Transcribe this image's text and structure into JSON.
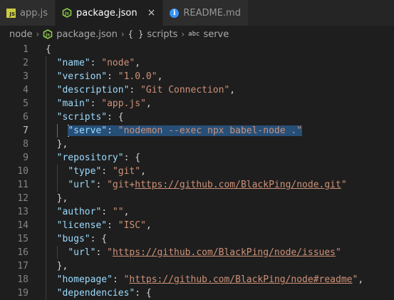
{
  "tabs": [
    {
      "label": "app.js",
      "icon": "js-icon",
      "active": false
    },
    {
      "label": "package.json",
      "icon": "nodejs-icon",
      "active": true,
      "close": "×"
    },
    {
      "label": "README.md",
      "icon": "info-icon",
      "active": false
    }
  ],
  "breadcrumb": {
    "root": "node",
    "file": "package.json",
    "section": "scripts",
    "section_glyph": "{ }",
    "leaf": "serve",
    "leaf_glyph": "abc",
    "separator": "›"
  },
  "editor": {
    "current_line": 7,
    "lines": [
      {
        "n": "1",
        "tokens": [
          [
            "p",
            "{"
          ]
        ]
      },
      {
        "n": "2",
        "tokens": [
          [
            "p",
            "  "
          ],
          [
            "k",
            "\"name\""
          ],
          [
            "p",
            ": "
          ],
          [
            "s",
            "\"node\""
          ],
          [
            "p",
            ","
          ]
        ]
      },
      {
        "n": "3",
        "tokens": [
          [
            "p",
            "  "
          ],
          [
            "k",
            "\"version\""
          ],
          [
            "p",
            ": "
          ],
          [
            "s",
            "\"1.0.0\""
          ],
          [
            "p",
            ","
          ]
        ]
      },
      {
        "n": "4",
        "tokens": [
          [
            "p",
            "  "
          ],
          [
            "k",
            "\"description\""
          ],
          [
            "p",
            ": "
          ],
          [
            "s",
            "\"Git Connection\""
          ],
          [
            "p",
            ","
          ]
        ]
      },
      {
        "n": "5",
        "tokens": [
          [
            "p",
            "  "
          ],
          [
            "k",
            "\"main\""
          ],
          [
            "p",
            ": "
          ],
          [
            "s",
            "\"app.js\""
          ],
          [
            "p",
            ","
          ]
        ]
      },
      {
        "n": "6",
        "tokens": [
          [
            "p",
            "  "
          ],
          [
            "k",
            "\"scripts\""
          ],
          [
            "p",
            ": {"
          ]
        ]
      },
      {
        "n": "7",
        "tokens": [
          [
            "p",
            "    "
          ],
          [
            "k",
            "\"serve\"",
            "sel"
          ],
          [
            "p",
            ": ",
            "sel"
          ],
          [
            "s",
            "\"nodemon --exec npx babel-node .\"",
            "sel"
          ]
        ]
      },
      {
        "n": "8",
        "tokens": [
          [
            "p",
            "  },"
          ]
        ]
      },
      {
        "n": "9",
        "tokens": [
          [
            "p",
            "  "
          ],
          [
            "k",
            "\"repository\""
          ],
          [
            "p",
            ": {"
          ]
        ]
      },
      {
        "n": "10",
        "tokens": [
          [
            "p",
            "    "
          ],
          [
            "k",
            "\"type\""
          ],
          [
            "p",
            ": "
          ],
          [
            "s",
            "\"git\""
          ],
          [
            "p",
            ","
          ]
        ]
      },
      {
        "n": "11",
        "tokens": [
          [
            "p",
            "    "
          ],
          [
            "k",
            "\"url\""
          ],
          [
            "p",
            ": "
          ],
          [
            "s",
            "\"git+"
          ],
          [
            "u",
            "https://github.com/BlackPing/node.git"
          ],
          [
            "s",
            "\""
          ]
        ]
      },
      {
        "n": "12",
        "tokens": [
          [
            "p",
            "  },"
          ]
        ]
      },
      {
        "n": "13",
        "tokens": [
          [
            "p",
            "  "
          ],
          [
            "k",
            "\"author\""
          ],
          [
            "p",
            ": "
          ],
          [
            "s",
            "\"\""
          ],
          [
            "p",
            ","
          ]
        ]
      },
      {
        "n": "14",
        "tokens": [
          [
            "p",
            "  "
          ],
          [
            "k",
            "\"license\""
          ],
          [
            "p",
            ": "
          ],
          [
            "s",
            "\"ISC\""
          ],
          [
            "p",
            ","
          ]
        ]
      },
      {
        "n": "15",
        "tokens": [
          [
            "p",
            "  "
          ],
          [
            "k",
            "\"bugs\""
          ],
          [
            "p",
            ": {"
          ]
        ]
      },
      {
        "n": "16",
        "tokens": [
          [
            "p",
            "    "
          ],
          [
            "k",
            "\"url\""
          ],
          [
            "p",
            ": "
          ],
          [
            "s",
            "\""
          ],
          [
            "u",
            "https://github.com/BlackPing/node/issues"
          ],
          [
            "s",
            "\""
          ]
        ]
      },
      {
        "n": "17",
        "tokens": [
          [
            "p",
            "  },"
          ]
        ]
      },
      {
        "n": "18",
        "tokens": [
          [
            "p",
            "  "
          ],
          [
            "k",
            "\"homepage\""
          ],
          [
            "p",
            ": "
          ],
          [
            "s",
            "\""
          ],
          [
            "u",
            "https://github.com/BlackPing/node#readme"
          ],
          [
            "s",
            "\""
          ],
          [
            "p",
            ","
          ]
        ]
      },
      {
        "n": "19",
        "tokens": [
          [
            "p",
            "  "
          ],
          [
            "k",
            "\"dependencies\""
          ],
          [
            "p",
            ": {"
          ]
        ]
      }
    ]
  },
  "colors": {
    "editor_bg": "#1e1e1e",
    "key": "#9cdcfe",
    "string": "#ce9178",
    "selection": "#264f78",
    "node_green": "#8cc84b",
    "js_yellow": "#cbcb41",
    "info_blue": "#3794ff"
  }
}
